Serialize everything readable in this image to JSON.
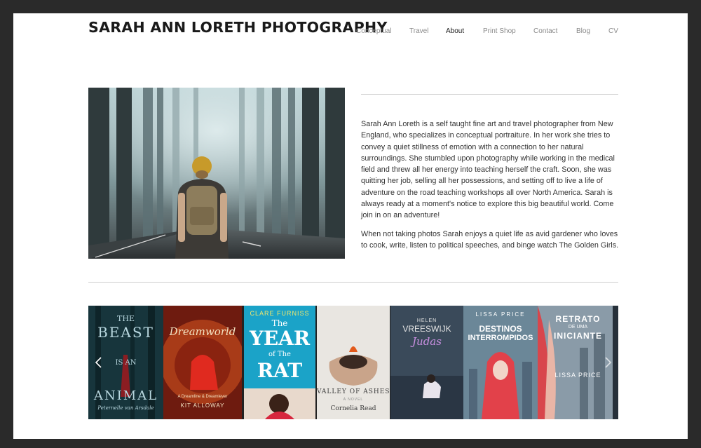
{
  "header": {
    "site_title": "SARAH ANN LORETH PHOTOGRAPHY"
  },
  "nav": {
    "items": [
      {
        "label": "Conceptual",
        "active": false
      },
      {
        "label": "Travel",
        "active": false
      },
      {
        "label": "About",
        "active": true
      },
      {
        "label": "Print Shop",
        "active": false
      },
      {
        "label": "Contact",
        "active": false
      },
      {
        "label": "Blog",
        "active": false
      },
      {
        "label": "CV",
        "active": false
      }
    ]
  },
  "about": {
    "paragraph_1": "Sarah Ann Loreth is a self taught fine art and travel photographer from New England, who specializes in conceptual portraiture. In her work she tries to convey a quiet stillness of emotion with a connection to her natural surroundings. She stumbled upon photography while working in the medical field and threw all her energy into teaching herself the craft. Soon, she was quitting her job, selling all her possessions, and setting off to live a life of adventure on the road teaching workshops all over North America. Sarah is always ready at a moment's notice to explore this big beautiful world. Come join in on an adventure!",
    "paragraph_2": "When not taking photos Sarah enjoys a quiet life as avid gardener who loves to cook, write, listen to political speeches, and binge watch The Golden Girls."
  },
  "books": [
    {
      "title_1": "THE",
      "title_2": "BEAST",
      "title_3": "IS AN",
      "title_4": "ANIMAL",
      "author": "Peternelle van Arsdale"
    },
    {
      "title_1": "Dreamworld",
      "series": "A Dreamline & Dreamlever",
      "author": "KIT ALLOWAY"
    },
    {
      "author": "CLARE FURNISS",
      "title_1": "The",
      "title_2": "YEAR",
      "title_3": "of The",
      "title_4": "RAT"
    },
    {
      "title_1": "VALLEY OF ASHES",
      "author": "Cornelia Read",
      "subtitle": "A NOVEL"
    },
    {
      "author": "HELEN",
      "author_2": "VREESWIJK",
      "title_1": "Judas"
    },
    {
      "author": "LISSA PRICE",
      "title_1": "DESTINOS",
      "title_2": "INTERROMPIDOS"
    },
    {
      "title_1": "RETRATO",
      "title_2": "DE UMA",
      "title_3": "INICIANTE",
      "author": "LISSA PRICE"
    }
  ],
  "carousel": {
    "prev_icon": "chevron-left-icon",
    "next_icon": "chevron-right-icon"
  }
}
